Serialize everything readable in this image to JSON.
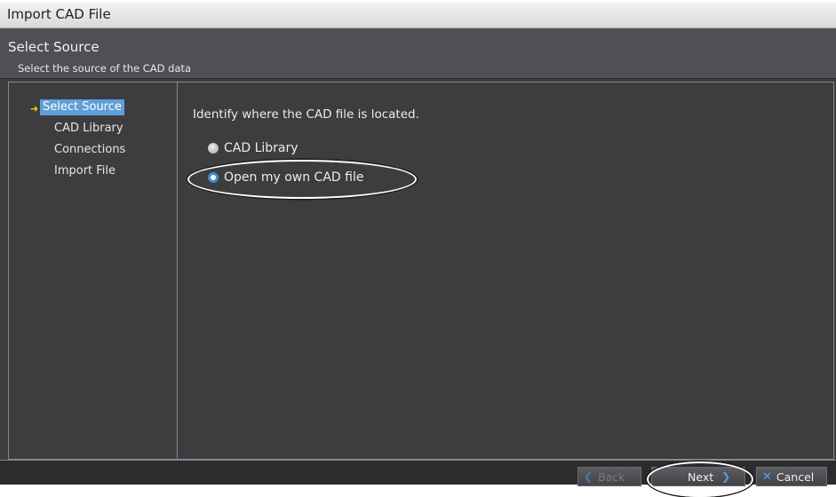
{
  "window": {
    "title": "Import CAD File"
  },
  "header": {
    "title": "Select Source",
    "subtitle": "Select the source of the CAD data"
  },
  "nav": {
    "items": [
      {
        "label": "Select Source",
        "selected": true
      },
      {
        "label": "CAD Library",
        "selected": false
      },
      {
        "label": "Connections",
        "selected": false
      },
      {
        "label": "Import File",
        "selected": false
      }
    ]
  },
  "main": {
    "question": "Identify where the CAD file is located.",
    "options": [
      {
        "label": "CAD Library",
        "checked": false
      },
      {
        "label": "Open my own CAD file",
        "checked": true
      }
    ]
  },
  "footer": {
    "back_label": "Back",
    "next_label": "Next",
    "cancel_label": "Cancel"
  },
  "colors": {
    "background": "#3d3d40",
    "selection": "#5e9fd8",
    "accent": "#4aa0f0",
    "arrow": "#f5d000"
  },
  "icons": {
    "nav_current": "arrow-right-icon",
    "back": "chevron-left-icon",
    "next": "chevron-right-icon",
    "cancel": "close-icon"
  }
}
